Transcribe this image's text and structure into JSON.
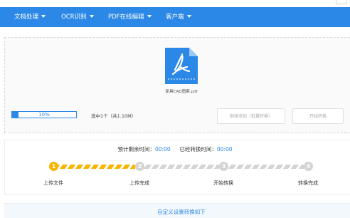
{
  "nav": {
    "items": [
      {
        "label": "文档处理"
      },
      {
        "label": "OCR识别"
      },
      {
        "label": "PDF在线编辑"
      },
      {
        "label": "客户端"
      }
    ]
  },
  "upload": {
    "file_name": "家具CAD图案.pdf",
    "progress_text": "10%",
    "progress_value": 0.1,
    "selected_info": "选中1个（共1.10M）",
    "add_button": "继续添加（批量转换）",
    "start_button": "开始转换"
  },
  "status": {
    "remaining_label": "预计剩余时间：",
    "remaining_value": "00:00",
    "elapsed_label": "已经转换时间：",
    "elapsed_value": "00:00"
  },
  "steps": [
    {
      "number": "1",
      "label": "上传文件"
    },
    {
      "number": "2",
      "label": "上传完成"
    },
    {
      "number": "3",
      "label": "开始转换"
    },
    {
      "number": "4",
      "label": "转换完成"
    }
  ],
  "custom_settings": "自定义设置转换如下",
  "colors": {
    "accent": "#2b88e6",
    "step_active": "#f7b500",
    "step_inactive": "#d4d4d4"
  },
  "icons": {
    "file": "pdf-file-icon",
    "caret": "caret-down-icon"
  }
}
